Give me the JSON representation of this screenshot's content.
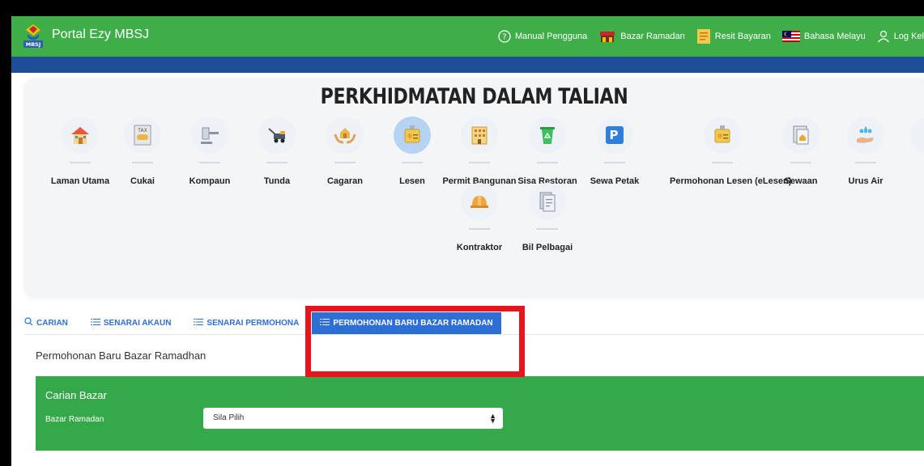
{
  "header": {
    "app_title": "Portal Ezy MBSJ",
    "logo_text": "MBSJ",
    "nav": [
      {
        "label": "Manual Pengguna",
        "icon": "help-circle-icon"
      },
      {
        "label": "Bazar Ramadan",
        "icon": "stall-icon"
      },
      {
        "label": "Resit Bayaran",
        "icon": "receipt-icon"
      },
      {
        "label": "Bahasa Melayu",
        "icon": "malaysia-flag-icon"
      },
      {
        "label": "Log Kel",
        "icon": "user-icon"
      }
    ]
  },
  "services": {
    "title": "PERKHIDMATAN DALAM TALIAN",
    "items": [
      {
        "label": "Laman Utama",
        "icon": "house-icon"
      },
      {
        "label": "Cukai",
        "icon": "tax-icon"
      },
      {
        "label": "Kompaun",
        "icon": "gavel-icon"
      },
      {
        "label": "Tunda",
        "icon": "tow-truck-icon"
      },
      {
        "label": "Cagaran",
        "icon": "hands-house-icon"
      },
      {
        "label": "Lesen",
        "icon": "license-badge-icon"
      },
      {
        "label": "Permit Bangunan",
        "icon": "building-icon"
      },
      {
        "label": "Sisa Restoran",
        "icon": "recycle-bin-icon"
      },
      {
        "label": "Sewa Petak",
        "icon": "parking-icon"
      },
      {
        "label": "Permohonan Lesen (eLesen)",
        "icon": "license-badge-icon"
      },
      {
        "label": "Sewaan",
        "icon": "document-house-icon"
      },
      {
        "label": "Urus Air",
        "icon": "water-hand-icon"
      },
      {
        "label": "Kontraktor",
        "icon": "hardhat-icon"
      },
      {
        "label": "Bil Pelbagai",
        "icon": "bill-icon"
      }
    ]
  },
  "tabs": [
    {
      "label": "CARIAN",
      "icon": "search-icon"
    },
    {
      "label": "SENARAI AKAUN",
      "icon": "list-icon"
    },
    {
      "label": "SENARAI PERMOHONA",
      "icon": "list-icon"
    },
    {
      "label": "PERMOHONAN BARU BAZAR RAMADAN",
      "icon": "list-icon"
    }
  ],
  "section_title": "Permohonan Baru Bazar Ramadhan",
  "form": {
    "title": "Carian Bazar",
    "field_label": "Bazar Ramadan",
    "select_value": "Sila Pilih"
  },
  "colors": {
    "header_green": "#3fae49",
    "header_strip_blue": "#1f4e99",
    "tab_blue": "#2e6fd6",
    "panel_green": "#35a84a",
    "highlight_red": "#e8141b"
  }
}
